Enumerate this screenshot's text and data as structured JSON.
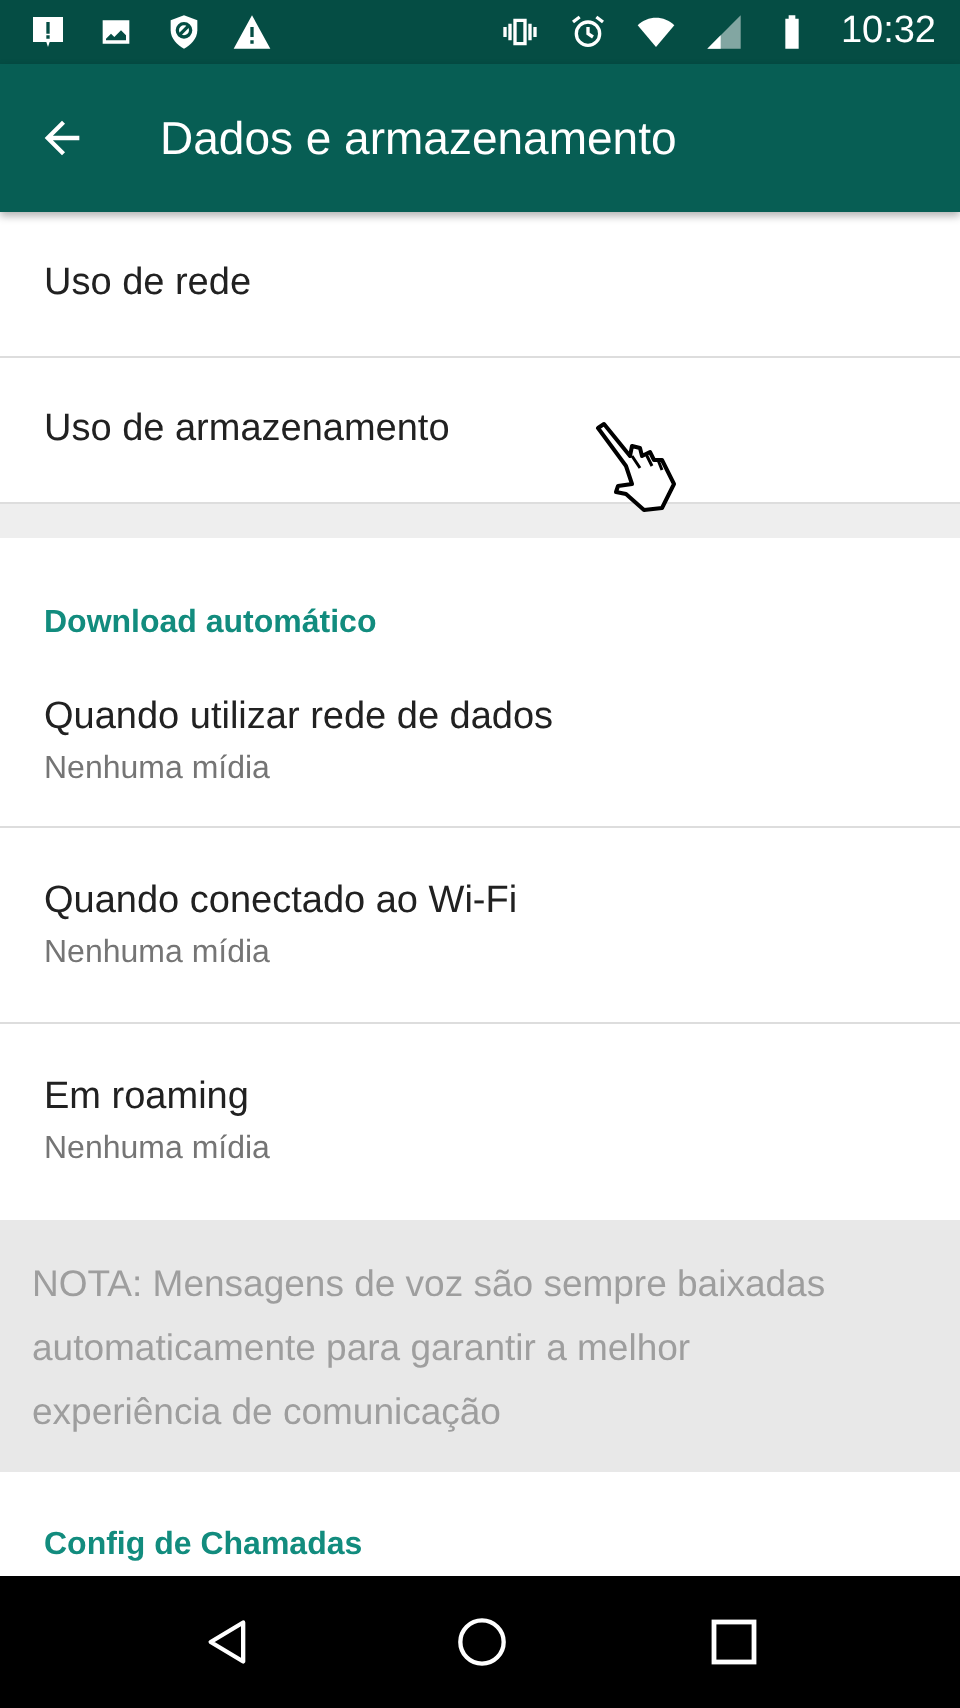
{
  "status_bar": {
    "time": "10:32"
  },
  "app_bar": {
    "title": "Dados e armazenamento"
  },
  "top_items": [
    {
      "title": "Uso de rede"
    },
    {
      "title": "Uso de armazenamento"
    }
  ],
  "download_section": {
    "header": "Download automático",
    "items": [
      {
        "title": "Quando utilizar rede de dados",
        "subtitle": "Nenhuma mídia"
      },
      {
        "title": "Quando conectado ao Wi-Fi",
        "subtitle": "Nenhuma mídia"
      },
      {
        "title": "Em roaming",
        "subtitle": "Nenhuma mídia"
      }
    ]
  },
  "note": "NOTA: Mensagens de voz são sempre baixadas automaticamente para garantir a melhor experiência de comunicação",
  "calls_section": {
    "header": "Config de Chamadas"
  }
}
